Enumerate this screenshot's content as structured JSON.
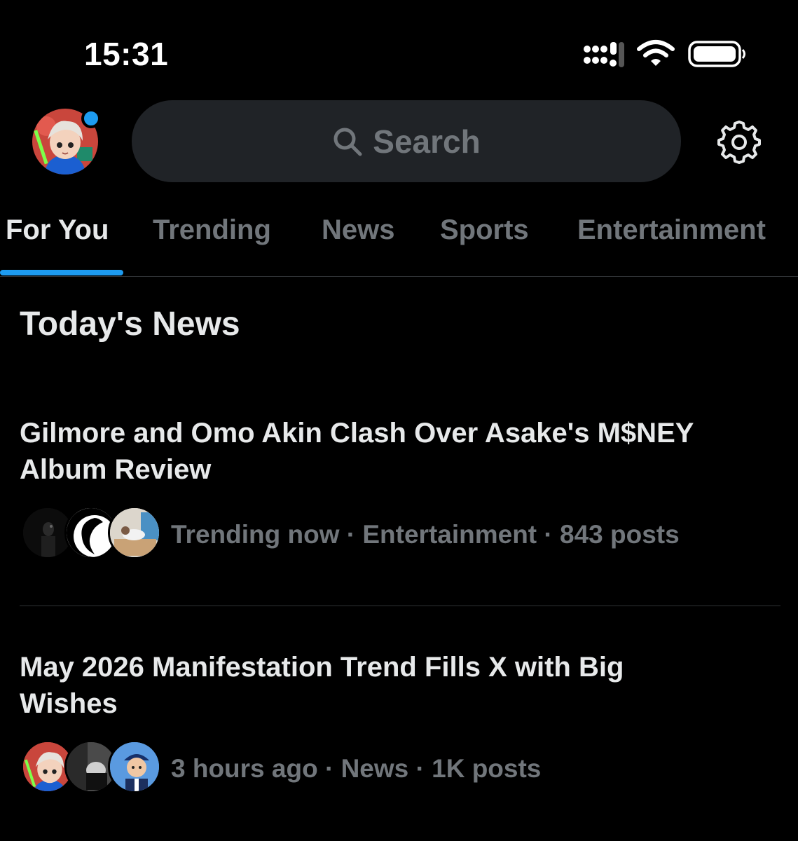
{
  "status_bar": {
    "time": "15:31",
    "icons": [
      "signal-icon",
      "wifi-icon",
      "battery-icon"
    ]
  },
  "header": {
    "avatar": "profile-avatar",
    "has_notification": true,
    "search_placeholder": "Search",
    "search_icon": "search-icon",
    "settings_icon": "gear-icon"
  },
  "tabs": [
    {
      "label": "For You",
      "active": true
    },
    {
      "label": "Trending",
      "active": false
    },
    {
      "label": "News",
      "active": false
    },
    {
      "label": "Sports",
      "active": false
    },
    {
      "label": "Entertainment",
      "active": false
    }
  ],
  "section": {
    "title": "Today's News"
  },
  "news": [
    {
      "headline": "Gilmore and Omo Akin Clash Over Asake's M$NEY Album Review",
      "meta": "Trending now · Entertainment · 843 posts",
      "avatars": [
        "dark-photo-avatar",
        "silhouette-avatar",
        "couch-photo-avatar"
      ]
    },
    {
      "headline": "May 2026 Manifestation Trend Fills X with Big Wishes",
      "meta": "3 hours ago · News · 1K posts",
      "avatars": [
        "anime-red-avatar",
        "gray-photo-avatar",
        "cartoon-blue-avatar"
      ]
    }
  ],
  "colors": {
    "background": "#000000",
    "accent": "#1d9bf0",
    "text_primary": "#e7e9ea",
    "text_secondary": "#71767b",
    "search_bg": "#202327"
  }
}
